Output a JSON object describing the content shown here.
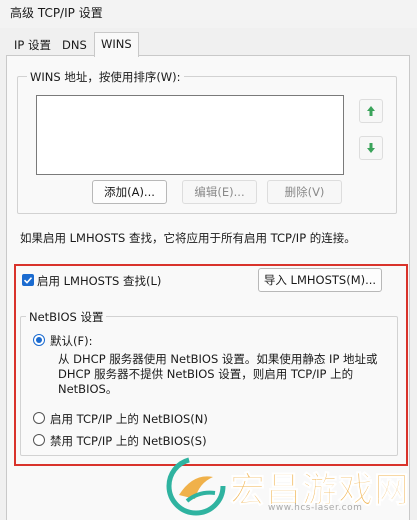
{
  "window": {
    "title": "高级 TCP/IP 设置"
  },
  "tabs": [
    {
      "label": "IP 设置"
    },
    {
      "label": "DNS"
    },
    {
      "label": "WINS",
      "active": true
    }
  ],
  "wins": {
    "group_label": "WINS 地址，按使用排序(W):",
    "addresses": [],
    "add_button": "添加(A)...",
    "edit_button": "编辑(E)...",
    "delete_button": "删除(V)",
    "move_up_icon": "arrow-up-icon",
    "move_down_icon": "arrow-down-icon"
  },
  "lmhosts": {
    "info": "如果启用 LMHOSTS 查找，它将应用于所有启用 TCP/IP 的连接。",
    "enable_label": "启用 LMHOSTS 查找(L)",
    "enable_checked": true,
    "import_button": "导入 LMHOSTS(M)..."
  },
  "netbios": {
    "group_label": "NetBIOS 设置",
    "options": [
      {
        "label": "默认(F):",
        "checked": true
      },
      {
        "label": "启用 TCP/IP 上的 NetBIOS(N)",
        "checked": false
      },
      {
        "label": "禁用 TCP/IP 上的 NetBIOS(S)",
        "checked": false
      }
    ],
    "default_desc": "从 DHCP 服务器使用 NetBIOS 设置。如果使用静态 IP 地址或 DHCP 服务器不提供 NetBIOS 设置，则启用 TCP/IP 上的 NetBIOS。"
  },
  "watermark": {
    "text": "宏昌游戏网",
    "url": "www.hcs-laser.com"
  },
  "colors": {
    "accent": "#1b6bd0",
    "highlight_border": "#d9332b",
    "arrow_green": "#3aa35a",
    "watermark": "#f0b14a"
  }
}
